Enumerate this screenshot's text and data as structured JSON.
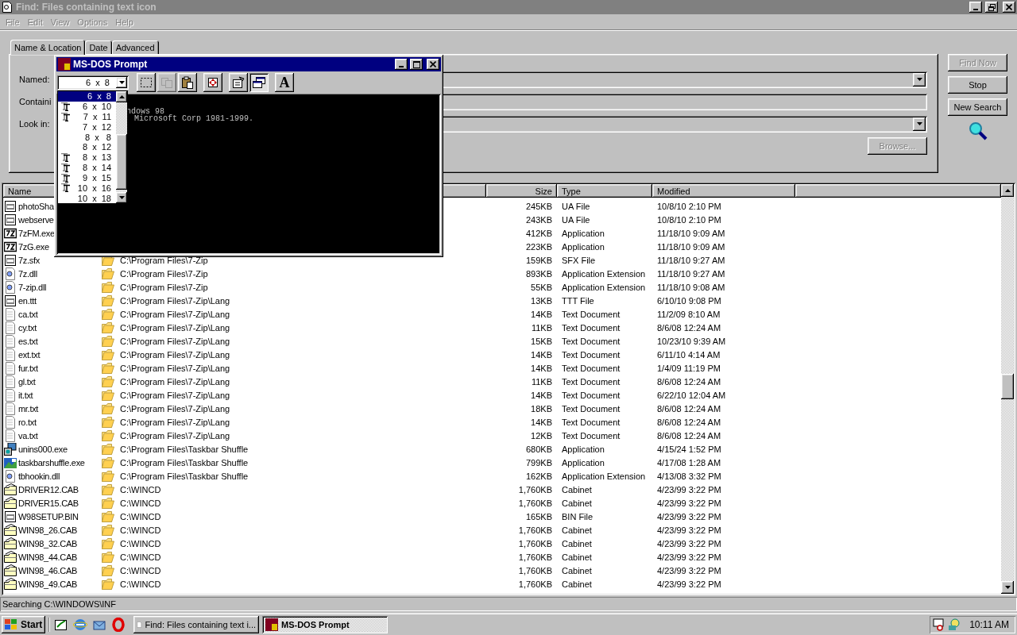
{
  "window": {
    "title": "Find: Files containing text icon"
  },
  "menu": [
    {
      "label": "File",
      "disabled": true
    },
    {
      "label": "Edit",
      "disabled": true
    },
    {
      "label": "View",
      "disabled": true
    },
    {
      "label": "Options",
      "disabled": true
    },
    {
      "label": "Help",
      "disabled": true
    }
  ],
  "tabs": [
    {
      "label": "Name & Location",
      "selected": true
    },
    {
      "label": "Date",
      "selected": false
    },
    {
      "label": "Advanced",
      "selected": false
    }
  ],
  "form": {
    "labels": [
      "Named:",
      "Containi",
      "Look in:"
    ],
    "browse": {
      "label": "Browse...",
      "disabled": true
    }
  },
  "buttons": [
    {
      "label": "Find Now",
      "disabled": true
    },
    {
      "label": "Stop",
      "disabled": false
    },
    {
      "label": "New Search",
      "disabled": false
    }
  ],
  "table": {
    "columns": [
      "Name",
      "",
      "Size",
      "Type",
      "Modified"
    ],
    "rows": [
      {
        "kind": "ua",
        "name": "photoSha",
        "size": "245KB",
        "type": "UA File",
        "modified": "10/8/10 2:10 PM"
      },
      {
        "kind": "ua",
        "name": "webserve",
        "size": "243KB",
        "type": "UA File",
        "modified": "10/8/10 2:10 PM"
      },
      {
        "kind": "archiver",
        "name": "7zFM.exe",
        "size": "412KB",
        "type": "Application",
        "modified": "11/18/10 9:09 AM"
      },
      {
        "kind": "archiver",
        "name": "7zG.exe",
        "size": "223KB",
        "type": "Application",
        "modified": "11/18/10 9:09 AM"
      },
      {
        "kind": "ua",
        "name": "7z.sfx",
        "folder": "C:\\Program Files\\7-Zip",
        "size": "159KB",
        "type": "SFX File",
        "modified": "11/18/10 9:27 AM"
      },
      {
        "kind": "dll",
        "name": "7z.dll",
        "folder": "C:\\Program Files\\7-Zip",
        "size": "893KB",
        "type": "Application Extension",
        "modified": "11/18/10 9:27 AM"
      },
      {
        "kind": "dll",
        "name": "7-zip.dll",
        "folder": "C:\\Program Files\\7-Zip",
        "size": "55KB",
        "type": "Application Extension",
        "modified": "11/18/10 9:08 AM"
      },
      {
        "kind": "ua",
        "name": "en.ttt",
        "folder": "C:\\Program Files\\7-Zip\\Lang",
        "size": "13KB",
        "type": "TTT File",
        "modified": "6/10/10 9:08 PM"
      },
      {
        "kind": "txt",
        "name": "ca.txt",
        "folder": "C:\\Program Files\\7-Zip\\Lang",
        "size": "14KB",
        "type": "Text Document",
        "modified": "11/2/09 8:10 AM"
      },
      {
        "kind": "txt",
        "name": "cy.txt",
        "folder": "C:\\Program Files\\7-Zip\\Lang",
        "size": "11KB",
        "type": "Text Document",
        "modified": "8/6/08 12:24 AM"
      },
      {
        "kind": "txt",
        "name": "es.txt",
        "folder": "C:\\Program Files\\7-Zip\\Lang",
        "size": "15KB",
        "type": "Text Document",
        "modified": "10/23/10 9:39 AM"
      },
      {
        "kind": "txt",
        "name": "ext.txt",
        "folder": "C:\\Program Files\\7-Zip\\Lang",
        "size": "14KB",
        "type": "Text Document",
        "modified": "6/11/10 4:14 AM"
      },
      {
        "kind": "txt",
        "name": "fur.txt",
        "folder": "C:\\Program Files\\7-Zip\\Lang",
        "size": "14KB",
        "type": "Text Document",
        "modified": "1/4/09 11:19 PM"
      },
      {
        "kind": "txt",
        "name": "gl.txt",
        "folder": "C:\\Program Files\\7-Zip\\Lang",
        "size": "11KB",
        "type": "Text Document",
        "modified": "8/6/08 12:24 AM"
      },
      {
        "kind": "txt",
        "name": "it.txt",
        "folder": "C:\\Program Files\\7-Zip\\Lang",
        "size": "14KB",
        "type": "Text Document",
        "modified": "6/22/10 12:04 AM"
      },
      {
        "kind": "txt",
        "name": "mr.txt",
        "folder": "C:\\Program Files\\7-Zip\\Lang",
        "size": "18KB",
        "type": "Text Document",
        "modified": "8/6/08 12:24 AM"
      },
      {
        "kind": "txt",
        "name": "ro.txt",
        "folder": "C:\\Program Files\\7-Zip\\Lang",
        "size": "14KB",
        "type": "Text Document",
        "modified": "8/6/08 12:24 AM"
      },
      {
        "kind": "txt",
        "name": "va.txt",
        "folder": "C:\\Program Files\\7-Zip\\Lang",
        "size": "12KB",
        "type": "Text Document",
        "modified": "8/6/08 12:24 AM"
      },
      {
        "kind": "setup",
        "name": "unins000.exe",
        "folder": "C:\\Program Files\\Taskbar Shuffle",
        "size": "680KB",
        "type": "Application",
        "modified": "4/15/24 1:52 PM"
      },
      {
        "kind": "app",
        "name": "taskbarshuffle.exe",
        "folder": "C:\\Program Files\\Taskbar Shuffle",
        "size": "799KB",
        "type": "Application",
        "modified": "4/17/08 1:28 AM"
      },
      {
        "kind": "dll",
        "name": "tbhookin.dll",
        "folder": "C:\\Program Files\\Taskbar Shuffle",
        "size": "162KB",
        "type": "Application Extension",
        "modified": "4/13/08 3:32 PM"
      },
      {
        "kind": "cab",
        "name": "DRIVER12.CAB",
        "folder": "C:\\WINCD",
        "size": "1,760KB",
        "type": "Cabinet",
        "modified": "4/23/99 3:22 PM"
      },
      {
        "kind": "cab",
        "name": "DRIVER15.CAB",
        "folder": "C:\\WINCD",
        "size": "1,760KB",
        "type": "Cabinet",
        "modified": "4/23/99 3:22 PM"
      },
      {
        "kind": "ua",
        "name": "W98SETUP.BIN",
        "folder": "C:\\WINCD",
        "size": "165KB",
        "type": "BIN File",
        "modified": "4/23/99 3:22 PM"
      },
      {
        "kind": "cab",
        "name": "WIN98_26.CAB",
        "folder": "C:\\WINCD",
        "size": "1,760KB",
        "type": "Cabinet",
        "modified": "4/23/99 3:22 PM"
      },
      {
        "kind": "cab",
        "name": "WIN98_32.CAB",
        "folder": "C:\\WINCD",
        "size": "1,760KB",
        "type": "Cabinet",
        "modified": "4/23/99 3:22 PM"
      },
      {
        "kind": "cab",
        "name": "WIN98_44.CAB",
        "folder": "C:\\WINCD",
        "size": "1,760KB",
        "type": "Cabinet",
        "modified": "4/23/99 3:22 PM"
      },
      {
        "kind": "cab",
        "name": "WIN98_46.CAB",
        "folder": "C:\\WINCD",
        "size": "1,760KB",
        "type": "Cabinet",
        "modified": "4/23/99 3:22 PM"
      },
      {
        "kind": "cab",
        "name": "WIN98_49.CAB",
        "folder": "C:\\WINCD",
        "size": "1,760KB",
        "type": "Cabinet",
        "modified": "4/23/99 3:22 PM"
      }
    ]
  },
  "status_bar": "Searching C:\\WINDOWS\\INF",
  "dos_window": {
    "title": "MS-DOS Prompt",
    "font_size": "6  x  8",
    "toolbar": [
      {
        "kind": "mark",
        "disabled": false,
        "pressed": false
      },
      {
        "kind": "copy",
        "disabled": true,
        "pressed": false
      },
      {
        "kind": "paste",
        "disabled": false,
        "pressed": false
      },
      {
        "kind": "fullscreen",
        "disabled": false,
        "pressed": false
      },
      {
        "kind": "properties",
        "disabled": false,
        "pressed": false
      },
      {
        "kind": "background",
        "disabled": false,
        "pressed": true
      },
      {
        "kind": "font",
        "label": "A",
        "disabled": false,
        "pressed": false
      }
    ],
    "font_list": [
      {
        "label": "6  x  8",
        "truetype": false,
        "selected": true
      },
      {
        "label": "6  x  10",
        "truetype": true,
        "selected": false
      },
      {
        "label": "7  x  11",
        "truetype": true,
        "selected": false
      },
      {
        "label": "7  x  12",
        "truetype": false,
        "selected": false
      },
      {
        "label": "8  x   8",
        "truetype": false,
        "selected": false
      },
      {
        "label": "8  x  12",
        "truetype": false,
        "selected": false
      },
      {
        "label": "8  x  13",
        "truetype": true,
        "selected": false
      },
      {
        "label": "8  x  14",
        "truetype": true,
        "selected": false
      },
      {
        "label": "9  x  15",
        "truetype": true,
        "selected": false
      },
      {
        "label": "10  x  16",
        "truetype": true,
        "selected": false
      },
      {
        "label": "10  x  18",
        "truetype": false,
        "selected": false
      }
    ],
    "console": [
      "ndows 98",
      "Microsoft Corp 1981-1999."
    ]
  },
  "taskbar": {
    "start": "Start",
    "quick_launch": [
      {
        "kind": "desktop"
      },
      {
        "kind": "browser"
      },
      {
        "kind": "mail"
      },
      {
        "kind": "opera"
      }
    ],
    "tasks": [
      {
        "label": "Find: Files containing text i...",
        "kind": "find",
        "selected": false
      },
      {
        "label": "MS-DOS Prompt",
        "kind": "dos",
        "selected": true
      }
    ],
    "clock": "10:11 AM"
  }
}
